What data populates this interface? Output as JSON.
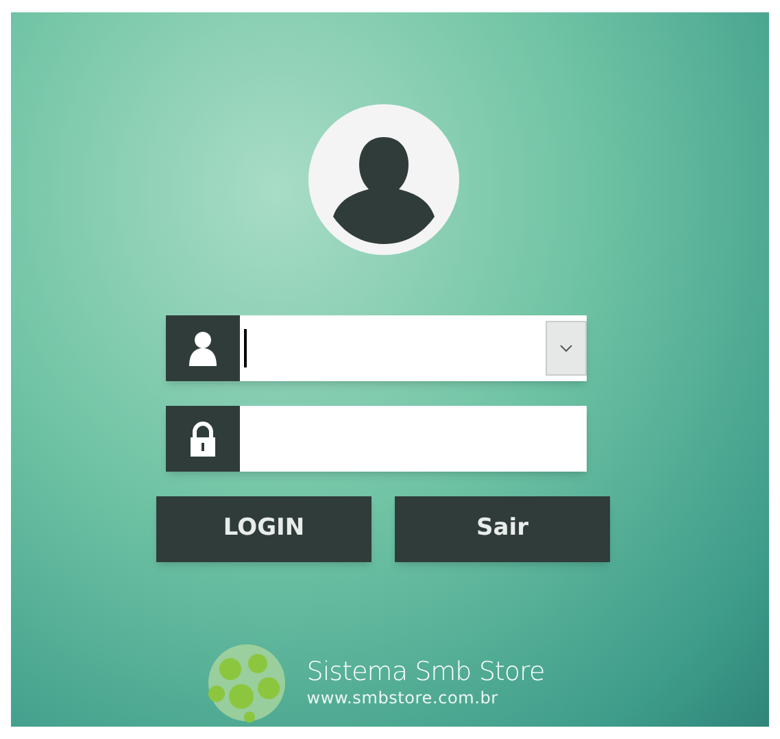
{
  "username_field": {
    "focused": true,
    "has_dropdown": true
  },
  "buttons": [
    {
      "label": "LOGIN"
    },
    {
      "label": "Sair"
    }
  ],
  "logo": {
    "name": "Sistema Smb Store",
    "url": "www.smbstore.com.br"
  }
}
